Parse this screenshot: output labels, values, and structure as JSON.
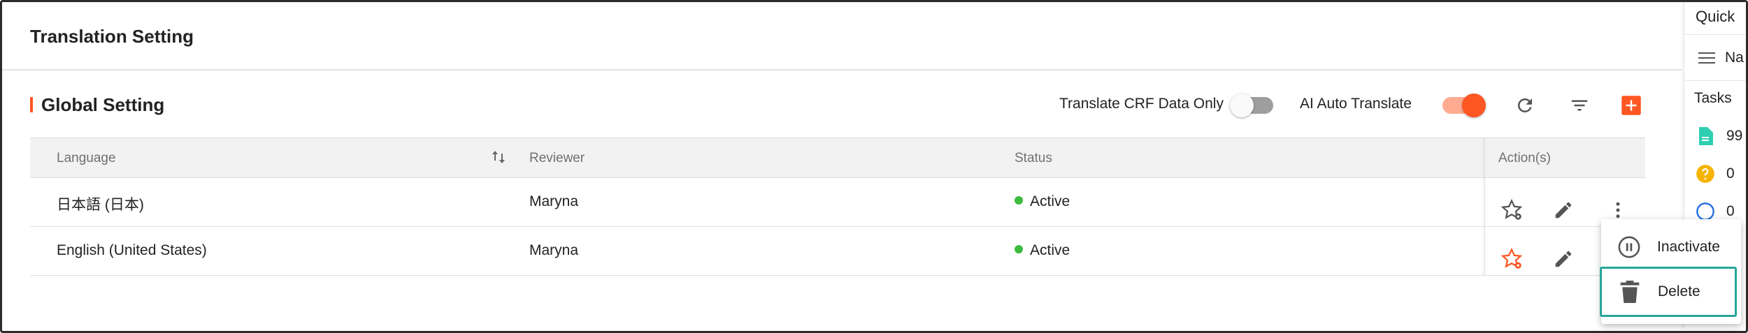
{
  "page": {
    "title": "Translation Setting"
  },
  "section": {
    "title": "Global Setting"
  },
  "toolbar": {
    "translate_crf_label": "Translate CRF Data Only",
    "translate_crf_on": false,
    "ai_auto_label": "AI Auto Translate",
    "ai_auto_on": true,
    "refresh_icon": "refresh-icon",
    "filter_icon": "filter-icon",
    "add_icon": "add-icon",
    "accent_color": "#ff5722"
  },
  "table": {
    "columns": [
      "Language",
      "Reviewer",
      "Status",
      "Action(s)"
    ],
    "rows": [
      {
        "language": "日本語 (日本)",
        "reviewer": "Maryna",
        "status": "Active"
      },
      {
        "language": "English (United States)",
        "reviewer": "Maryna",
        "status": "Active"
      }
    ],
    "status_color": "#3dbb3d"
  },
  "menu": {
    "items": [
      {
        "label": "Inactivate",
        "icon": "pause-circle-icon"
      },
      {
        "label": "Delete",
        "icon": "trash-icon"
      }
    ],
    "highlight_color": "#26a69a"
  },
  "side_panel": {
    "title": "Quick",
    "nav_label": "Na",
    "tasks_label": "Tasks",
    "items": [
      {
        "icon": "document-icon",
        "value": "99"
      },
      {
        "icon": "question-icon",
        "value": "0"
      },
      {
        "icon": "help-circle-icon",
        "value": "0"
      }
    ]
  }
}
